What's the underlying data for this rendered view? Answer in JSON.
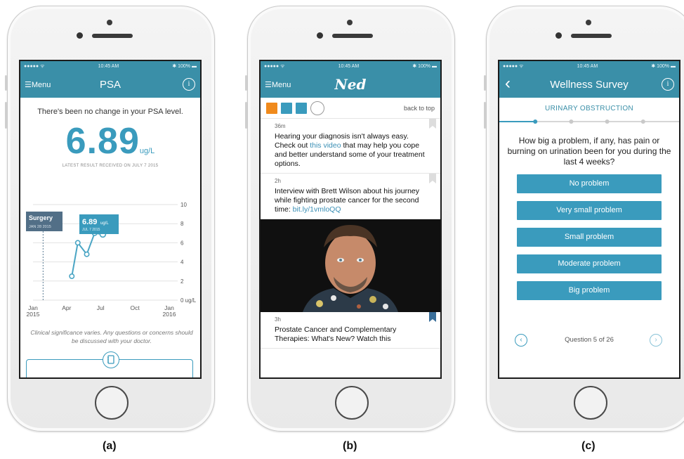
{
  "panels": [
    {
      "caption": "(a)",
      "status": {
        "carrier": "●●●●● ᯤ",
        "time": "10:45 AM",
        "battery": "✱ 100% ▬"
      },
      "nav": {
        "menu": "☰Menu",
        "title": "PSA",
        "info": "i"
      },
      "message": "There's been no change in your PSA level.",
      "value": "6.89",
      "unit": "ug/L",
      "subtitle": "LATEST RESULT RECEIVED ON JULY 7 2015",
      "surgery": {
        "label": "Surgery",
        "date": "JAN 28 2015"
      },
      "latest": {
        "value": "6.89",
        "unit": "ug/L",
        "date": "JUL 7 2015"
      },
      "note": "Clinical significance varies. Any questions or concerns should be discussed with your doctor."
    },
    {
      "caption": "(b)",
      "status": {
        "carrier": "●●●●● ᯤ",
        "time": "10:45 AM",
        "battery": "✱ 100% ▬"
      },
      "nav": {
        "menu": "☰Menu",
        "logo": "Ned"
      },
      "toolbar": {
        "back_to_top": "back to top"
      },
      "posts": [
        {
          "time": "36m",
          "text_a": "Hearing your diagnosis isn't always easy. Check out ",
          "link": "this video",
          "text_b": " that may help you cope and better understand some of your treatment options."
        },
        {
          "time": "2h",
          "text_a": "Interview with Brett Wilson about his journey while fighting prostate cancer for the second time: ",
          "link": "bit.ly/1vmloQQ",
          "text_b": ""
        },
        {
          "time": "3h",
          "text_a": "Prostate Cancer and Complementary Therapies: What's New? Watch this",
          "link": "",
          "text_b": ""
        }
      ]
    },
    {
      "caption": "(c)",
      "status": {
        "carrier": "●●●●● ᯤ",
        "time": "10:45 AM",
        "battery": "✱ 100% ▬"
      },
      "nav": {
        "back": "‹",
        "title": "Wellness Survey",
        "info": "i"
      },
      "category": "URINARY OBSTRUCTION",
      "progress": 0.2,
      "question": "How big a problem, if any, has pain or burning on urination been for you during the last 4 weeks?",
      "options": [
        "No problem",
        "Very small problem",
        "Small problem",
        "Moderate problem",
        "Big problem"
      ],
      "counter": "Question 5 of 26",
      "prev": "‹",
      "next": "›"
    }
  ],
  "chart_data": {
    "type": "line",
    "x": [
      "2015-04-15",
      "2015-05-01",
      "2015-05-25",
      "2015-06-15",
      "2015-07-07"
    ],
    "values": [
      2.5,
      6.0,
      4.8,
      7.0,
      6.89
    ],
    "x_tick_labels": [
      "Jan\n2015",
      "Apr",
      "Jul",
      "Oct",
      "Jan\n2016"
    ],
    "y_ticks": [
      0,
      2,
      4,
      6,
      8,
      10
    ],
    "y_tick_labels": [
      "0 ug/L",
      "2",
      "4",
      "6",
      "8",
      "10"
    ],
    "ylim": [
      0,
      10
    ],
    "xlim": [
      "2015-01-01",
      "2016-01-01"
    ],
    "grid": true,
    "color": "#4aa5c4"
  }
}
